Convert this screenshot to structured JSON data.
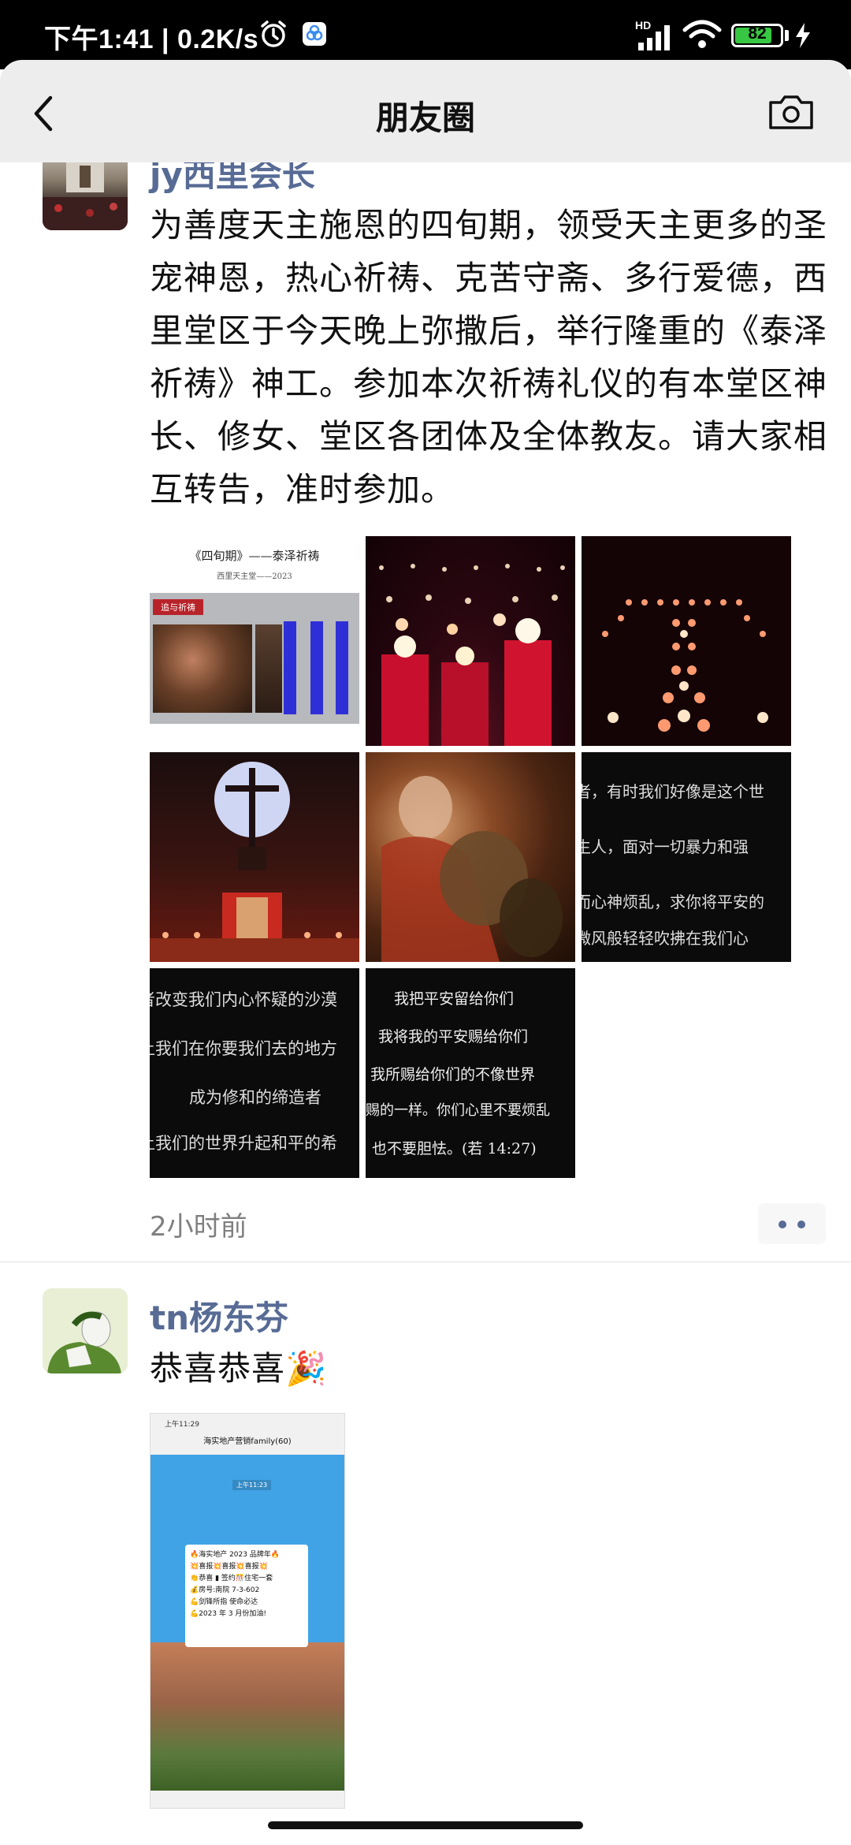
{
  "status_bar": {
    "time": "下午1:41 | 0.2K/s",
    "network_type": "HD",
    "battery_level": 82,
    "battery_label": "82"
  },
  "header": {
    "title": "朋友圈"
  },
  "posts": [
    {
      "author": "jy西里会长",
      "text": "为善度天主施恩的四旬期，领受天主更多的圣宠神恩，热心祈祷、克苦守斋、多行爱德，西里堂区于今天晚上弥撒后，举行隆重的《泰泽祈祷》神工。参加本次祈祷礼仪的有本堂区神长、修女、堂区各团体及全体教友。请大家相互转告，准时参加。",
      "time": "2小时前",
      "images": {
        "poster_title": "《四旬期》——泰泽祈祷",
        "poster_subtitle": "西里天主堂——2023",
        "poster_tag": "追与祈祷",
        "quote1": [
          "者，有时我们好像是这个世",
          "生人，面对一切暴力和强",
          "而心神烦乱，求你将平安的",
          "微风般轻轻吹拂在我们心"
        ],
        "quote2": [
          "者改变我们内心怀疑的沙漠",
          "让我们在你要我们去的地方",
          "成为修和的缔造者",
          "让我们的世界升起和平的希"
        ],
        "quote3": [
          "我把平安留给你们",
          "我将我的平安赐给你们",
          "我所赐给你们的不像世界",
          "赐的一样。你们心里不要烦乱",
          "也不要胆怯。(若 14:27)"
        ]
      }
    },
    {
      "author": "tn杨东芬",
      "text": "恭喜恭喜🎉",
      "screenshot": {
        "time": "上午11:29",
        "chat_title": "海实地产营销family(60)",
        "bubble_time": "上午11:23",
        "message_lines": [
          "🔥海实地产 2023 品牌年🔥",
          "💥喜报💥喜报💥喜报💥",
          "👏恭喜 ▮ 签约🎊住宅一套",
          "💰房号:南院 7-3-602",
          "",
          "💪剑锋所指 使命必达",
          "💪2023 年 3 月份加油!"
        ]
      }
    }
  ]
}
